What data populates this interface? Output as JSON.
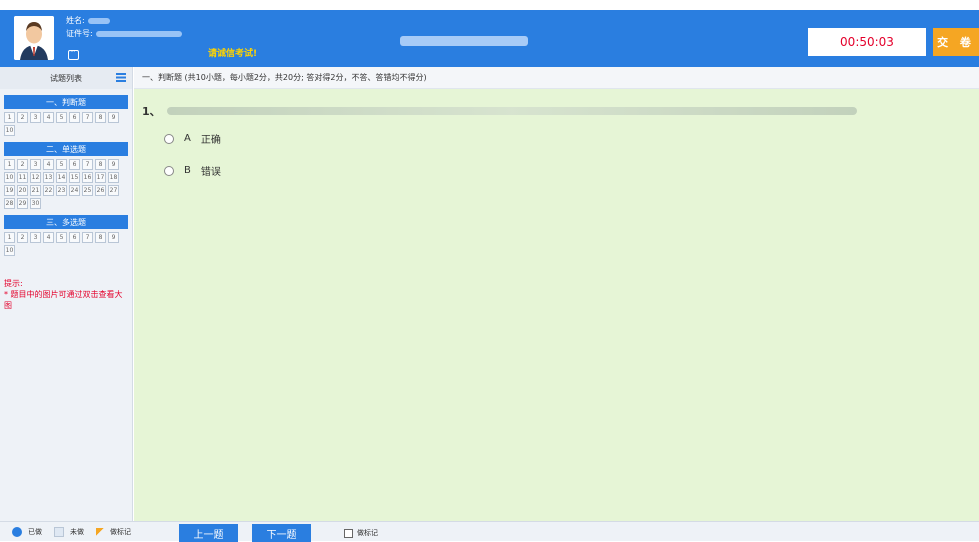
{
  "header": {
    "name_label": "姓名:",
    "id_label": "证件号:",
    "notice": "请诚信考试!",
    "timer": "00:50:03",
    "submit_label": "交 卷"
  },
  "sidebar": {
    "title": "试题列表",
    "sections": [
      {
        "title": "一、判断题",
        "numbers": [
          "1",
          "2",
          "3",
          "4",
          "5",
          "6",
          "7",
          "8",
          "9",
          "10"
        ]
      },
      {
        "title": "二、单选题",
        "numbers": [
          "1",
          "2",
          "3",
          "4",
          "5",
          "6",
          "7",
          "8",
          "9",
          "10",
          "11",
          "12",
          "13",
          "14",
          "15",
          "16",
          "17",
          "18",
          "19",
          "20",
          "21",
          "22",
          "23",
          "24",
          "25",
          "26",
          "27",
          "28",
          "29",
          "30"
        ]
      },
      {
        "title": "三、多选题",
        "numbers": [
          "1",
          "2",
          "3",
          "4",
          "5",
          "6",
          "7",
          "8",
          "9",
          "10"
        ]
      }
    ],
    "tip_title": "提示:",
    "tip_text": "* 题目中的图片可通过双击查看大图"
  },
  "question_type_bar": "一、判断题 (共10小题，每小题2分，共20分; 答对得2分，不答、答错均不得分)",
  "question": {
    "number": "1、",
    "options": [
      {
        "letter": "A",
        "text": "正确"
      },
      {
        "letter": "B",
        "text": "错误"
      }
    ]
  },
  "footer": {
    "legend_done": "已做",
    "legend_undone": "未做",
    "legend_marked": "做标记",
    "prev_label": "上一题",
    "next_label": "下一题",
    "mark_label": "做标记"
  },
  "colors": {
    "primary": "#2a7ee0",
    "accent": "#f5a623",
    "timer": "#e4002b",
    "content_bg": "#e6f5d6"
  }
}
